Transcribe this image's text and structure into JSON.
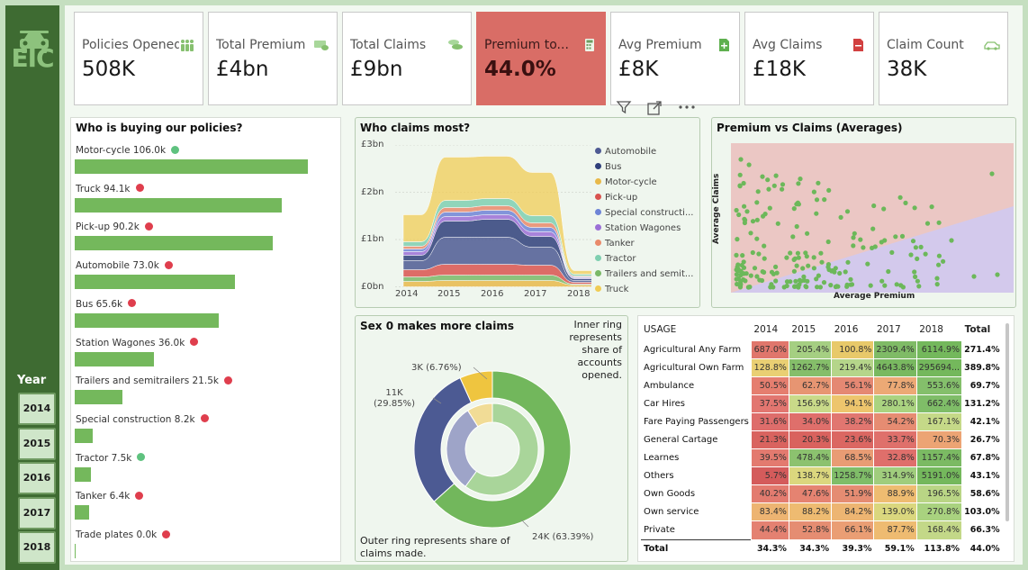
{
  "brand": {
    "logo_text": "EIC",
    "accent": "#3e6b32"
  },
  "filter": {
    "label": "Year",
    "years": [
      "2014",
      "2015",
      "2016",
      "2017",
      "2018"
    ]
  },
  "kpis": [
    {
      "label": "Policies Opened",
      "value": "508K",
      "icon": "people-icon"
    },
    {
      "label": "Total Premium",
      "value": "£4bn",
      "icon": "money-icon"
    },
    {
      "label": "Total Claims",
      "value": "£9bn",
      "icon": "coins-icon"
    },
    {
      "label": "Premium to...",
      "value": "44.0%",
      "icon": "calculator-icon",
      "highlight_color": "#d96d66"
    },
    {
      "label": "Avg Premium",
      "value": "£8K",
      "icon": "document-plus-icon"
    },
    {
      "label": "Avg Claims",
      "value": "£18K",
      "icon": "document-minus-icon"
    },
    {
      "label": "Claim Count",
      "value": "38K",
      "icon": "car-icon"
    }
  ],
  "buyers": {
    "title": "Who is buying our policies?",
    "items": [
      {
        "label": "Motor-cycle 106.0k",
        "value": 106.0,
        "status": "green"
      },
      {
        "label": "Truck 94.1k",
        "value": 94.1,
        "status": "red"
      },
      {
        "label": "Pick-up 90.2k",
        "value": 90.2,
        "status": "red"
      },
      {
        "label": "Automobile 73.0k",
        "value": 73.0,
        "status": "red"
      },
      {
        "label": "Bus 65.6k",
        "value": 65.6,
        "status": "red"
      },
      {
        "label": "Station Wagones 36.0k",
        "value": 36.0,
        "status": "red"
      },
      {
        "label": "Trailers and semitrailers 21.5k",
        "value": 21.5,
        "status": "red"
      },
      {
        "label": "Special construction 8.2k",
        "value": 8.2,
        "status": "red"
      },
      {
        "label": "Tractor 7.5k",
        "value": 7.5,
        "status": "green"
      },
      {
        "label": "Tanker 6.4k",
        "value": 6.4,
        "status": "red"
      },
      {
        "label": "Trade plates 0.0k",
        "value": 0.0,
        "status": "red"
      }
    ]
  },
  "claims_chart": {
    "title": "Who claims most?",
    "y_ticks": [
      "£3bn",
      "£2bn",
      "£1bn",
      "£0bn"
    ],
    "x_ticks": [
      "2014",
      "2015",
      "2016",
      "2017",
      "2018"
    ],
    "legend": [
      {
        "name": "Automobile",
        "color": "#4e5a93"
      },
      {
        "name": "Bus",
        "color": "#2f3f7a"
      },
      {
        "name": "Motor-cycle",
        "color": "#e8b94a"
      },
      {
        "name": "Pick-up",
        "color": "#d9534f"
      },
      {
        "name": "Special constructi...",
        "color": "#6e84d6"
      },
      {
        "name": "Station Wagones",
        "color": "#9b6fd6"
      },
      {
        "name": "Tanker",
        "color": "#e98a6b"
      },
      {
        "name": "Tractor",
        "color": "#7fcfb0"
      },
      {
        "name": "Trailers and semit...",
        "color": "#7ab867"
      },
      {
        "name": "Truck",
        "color": "#f0cc55"
      }
    ]
  },
  "scatter": {
    "title": "Premium vs Claims (Averages)",
    "xlabel": "Average Premium",
    "ylabel": "Average Claims"
  },
  "donut": {
    "title": "Sex 0 makes more claims",
    "inner_note": "Inner ring represents share of accounts opened.",
    "outer_note": "Outer ring represents share of claims made.",
    "labels": [
      {
        "text": "3K (6.76%)",
        "pct": 6.76,
        "color": "#efc53f"
      },
      {
        "text": "11K (29.85%)",
        "pct": 29.85,
        "color": "#4c5a93"
      },
      {
        "text": "24K (63.39%)",
        "pct": 63.39,
        "color": "#72b75c"
      }
    ]
  },
  "usage_table": {
    "headers": [
      "USAGE",
      "2014",
      "2015",
      "2016",
      "2017",
      "2018",
      "Total"
    ],
    "rows": [
      {
        "label": "Agricultural Any Farm",
        "cells": [
          "687.0%",
          "205.4%",
          "100.8%",
          "2309.4%",
          "6114.9%"
        ],
        "colors": [
          "#e0766c",
          "#a5cf82",
          "#e8c96a",
          "#7fbb66",
          "#74b85c"
        ],
        "total": "271.4%"
      },
      {
        "label": "Agricultural Own Farm",
        "cells": [
          "128.8%",
          "1262.7%",
          "219.4%",
          "4643.8%",
          "295694..."
        ],
        "colors": [
          "#e9cf73",
          "#85be6a",
          "#b5d58a",
          "#79b960",
          "#74b85c"
        ],
        "total": "389.8%"
      },
      {
        "label": "Ambulance",
        "cells": [
          "50.5%",
          "62.7%",
          "56.1%",
          "77.8%",
          "553.6%"
        ],
        "colors": [
          "#e57e6f",
          "#e79572",
          "#e58873",
          "#eca975",
          "#84bf6b"
        ],
        "total": "69.7%"
      },
      {
        "label": "Car Hires",
        "cells": [
          "37.5%",
          "156.9%",
          "94.1%",
          "280.1%",
          "662.4%"
        ],
        "colors": [
          "#e27670",
          "#c9da89",
          "#edc56d",
          "#aad380",
          "#7fbd68"
        ],
        "total": "131.2%"
      },
      {
        "label": "Fare Paying Passengers",
        "cells": [
          "31.6%",
          "34.0%",
          "38.2%",
          "54.2%",
          "167.1%"
        ],
        "colors": [
          "#de6d6b",
          "#df6f6b",
          "#e17670",
          "#e68c72",
          "#c5d988"
        ],
        "total": "42.1%"
      },
      {
        "label": "General Cartage",
        "cells": [
          "21.3%",
          "20.3%",
          "23.6%",
          "33.7%",
          "70.3%"
        ],
        "colors": [
          "#d9635f",
          "#d9625e",
          "#db6762",
          "#df706b",
          "#eca474"
        ],
        "total": "26.7%"
      },
      {
        "label": "Learnes",
        "cells": [
          "39.5%",
          "478.4%",
          "68.5%",
          "32.8%",
          "1157.4%"
        ],
        "colors": [
          "#e37a6f",
          "#8cc26f",
          "#e99c74",
          "#df6f6b",
          "#7bba63"
        ],
        "total": "67.8%"
      },
      {
        "label": "Others",
        "cells": [
          "5.7%",
          "138.7%",
          "1258.7%",
          "314.9%",
          "5191.0%"
        ],
        "colors": [
          "#d45b5b",
          "#dbd77e",
          "#7fbd68",
          "#a0cd7d",
          "#74b85c"
        ],
        "total": "43.1%"
      },
      {
        "label": "Own Goods",
        "cells": [
          "40.2%",
          "47.6%",
          "51.9%",
          "88.9%",
          "196.5%"
        ],
        "colors": [
          "#e37b6f",
          "#e58371",
          "#e58c72",
          "#eebc71",
          "#b9d585"
        ],
        "total": "58.6%"
      },
      {
        "label": "Own service",
        "cells": [
          "83.4%",
          "88.2%",
          "84.2%",
          "139.0%",
          "270.8%"
        ],
        "colors": [
          "#edb472",
          "#eebb71",
          "#edb572",
          "#dad77e",
          "#a9d27f"
        ],
        "total": "103.0%"
      },
      {
        "label": "Private",
        "cells": [
          "44.4%",
          "52.8%",
          "66.1%",
          "87.7%",
          "168.4%"
        ],
        "colors": [
          "#e48171",
          "#e58d72",
          "#ea9e74",
          "#eebb71",
          "#c3d888"
        ],
        "total": "66.3%"
      }
    ],
    "total_row": {
      "label": "Total",
      "cells": [
        "34.3%",
        "34.3%",
        "39.3%",
        "59.1%",
        "113.8%"
      ],
      "total": "44.0%"
    }
  }
}
